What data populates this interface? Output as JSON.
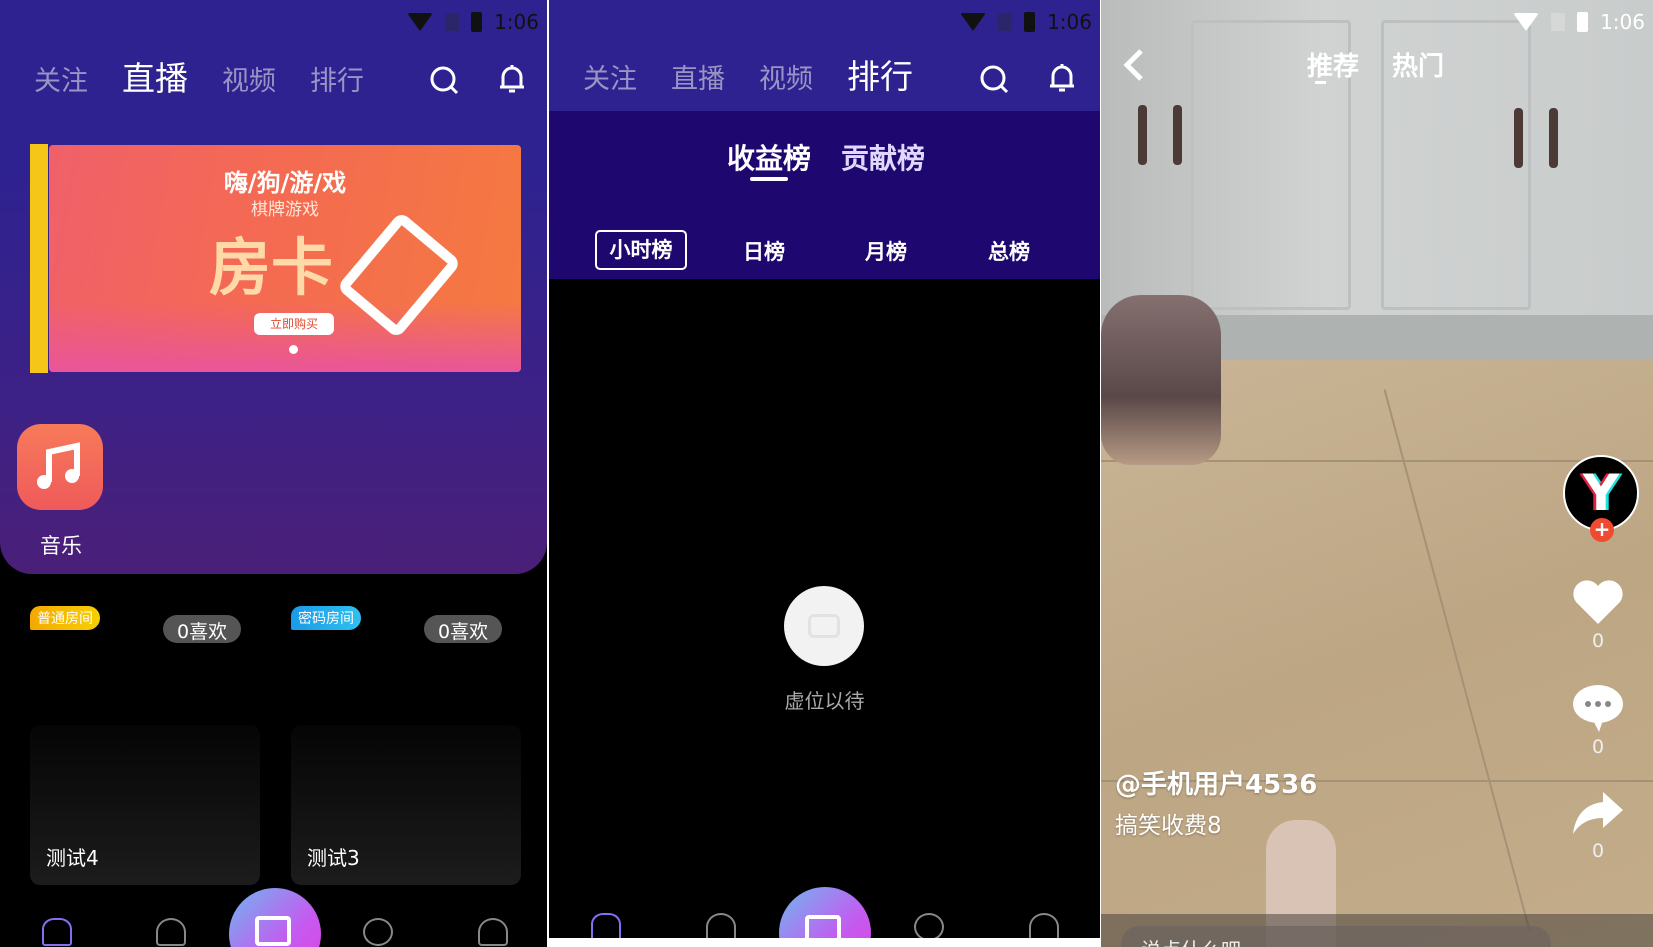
{
  "status_bar": {
    "time": "1:06"
  },
  "live_screen": {
    "tabs": [
      {
        "label": "关注"
      },
      {
        "label": "直播"
      },
      {
        "label": "视频"
      },
      {
        "label": "排行"
      }
    ],
    "active_tab": "直播",
    "banner": {
      "title": "嗨/狗/游/戏",
      "subtitle": "棋牌游戏",
      "headline": "房卡",
      "button": "立即购买"
    },
    "category": {
      "label": "音乐",
      "color": "#f26a5a"
    },
    "rooms": [
      {
        "badge": "普通房间",
        "badge_color": "#f5b800",
        "likes": "0喜欢",
        "title": "测试4"
      },
      {
        "badge": "密码房间",
        "badge_color": "#1ea8f0",
        "likes": "0喜欢",
        "title": "测试3"
      }
    ]
  },
  "rank_screen": {
    "tabs": [
      {
        "label": "关注"
      },
      {
        "label": "直播"
      },
      {
        "label": "视频"
      },
      {
        "label": "排行"
      }
    ],
    "active_tab": "排行",
    "board_tabs": [
      {
        "label": "收益榜"
      },
      {
        "label": "贡献榜"
      }
    ],
    "active_board": "收益榜",
    "period_tabs": [
      {
        "label": "小时榜"
      },
      {
        "label": "日榜"
      },
      {
        "label": "月榜"
      },
      {
        "label": "总榜"
      }
    ],
    "active_period": "小时榜",
    "empty_text": "虚位以待"
  },
  "video_screen": {
    "tabs": [
      {
        "label": "推荐"
      },
      {
        "label": "热门"
      }
    ],
    "active_tab": "推荐",
    "author": "@手机用户4536",
    "caption": "搞笑收费8",
    "likes": "0",
    "comments": "0",
    "shares": "0",
    "comment_placeholder": "说点什么吧"
  },
  "colors": {
    "header": "#2e2290",
    "subheader": "#1e0870",
    "accent": "#c55af0"
  }
}
